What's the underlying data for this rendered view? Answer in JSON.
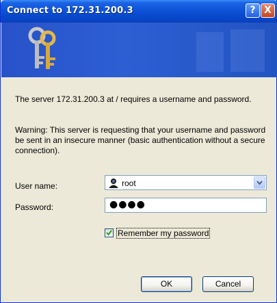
{
  "window": {
    "title": "Connect to 172.31.200.3"
  },
  "title_buttons": {
    "help": "?",
    "close": "X"
  },
  "message": {
    "line1": "The server 172.31.200.3 at / requires a username and password.",
    "warning": "Warning: This server is requesting that your username and password be sent in an insecure manner (basic authentication without a secure connection)."
  },
  "form": {
    "username_label": "User name:",
    "username_value": "root",
    "password_label": "Password:",
    "password_value": "●●●●",
    "remember_label": "Remember my password",
    "remember_checked": true
  },
  "buttons": {
    "ok": "OK",
    "cancel": "Cancel"
  },
  "colors": {
    "titlebar": "#0a4ed3",
    "banner": "#2852c9",
    "dialog_bg": "#ece9d8"
  }
}
